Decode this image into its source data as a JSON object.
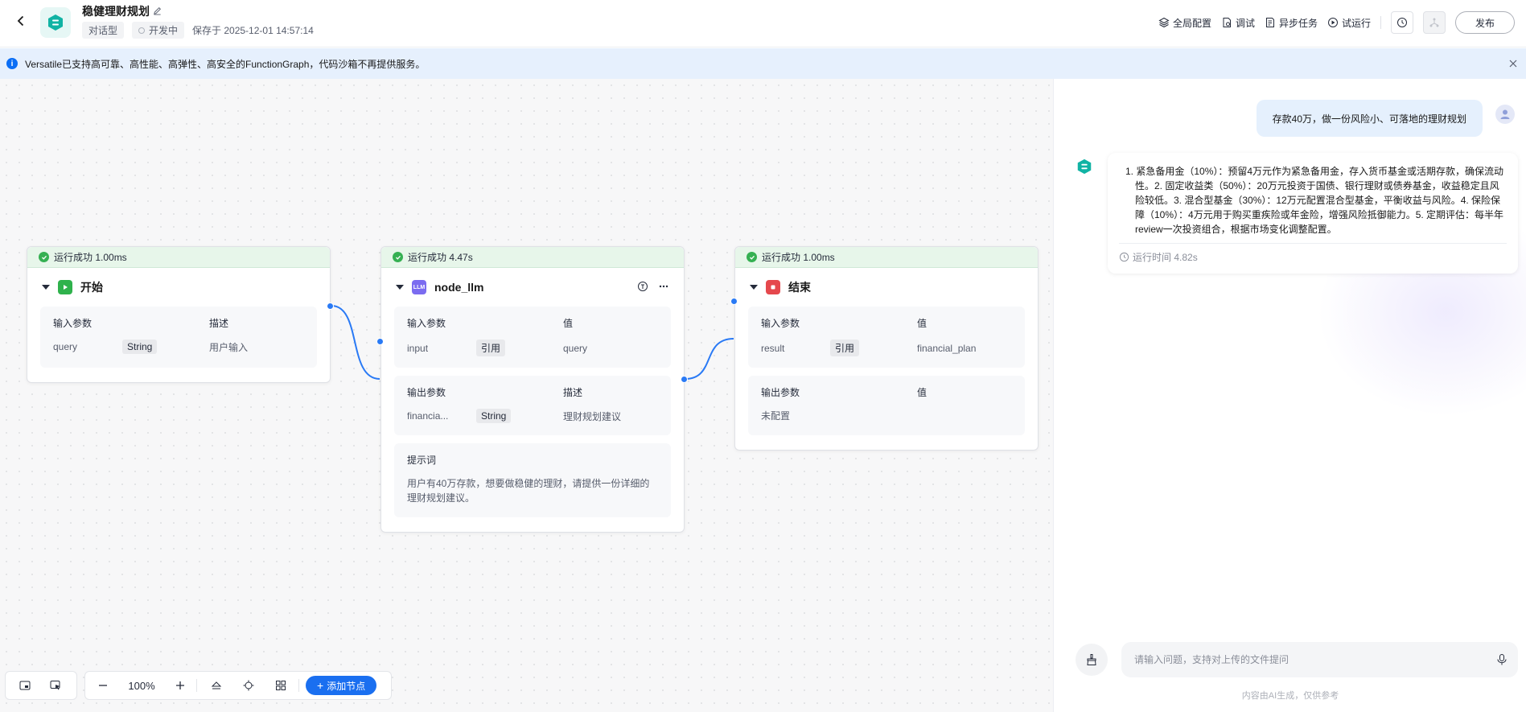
{
  "header": {
    "title": "稳健理财规划",
    "tag_type": "对话型",
    "status": "开发中",
    "saved_at": "保存于 2025-12-01 14:57:14",
    "actions": {
      "global_config": "全局配置",
      "debug": "调试",
      "async_tasks": "异步任务",
      "trial_run": "试运行",
      "publish": "发布"
    }
  },
  "notice": {
    "text": "Versatile已支持高可靠、高性能、高弹性、高安全的FunctionGraph，代码沙箱不再提供服务。"
  },
  "nodes": {
    "start": {
      "status": "运行成功 1.00ms",
      "name": "开始",
      "input_header": [
        "输入参数",
        "描述"
      ],
      "input_row": {
        "name": "query",
        "type": "String",
        "desc": "用户输入"
      }
    },
    "llm": {
      "status": "运行成功 4.47s",
      "name": "node_llm",
      "input_header": [
        "输入参数",
        "值"
      ],
      "input_row": {
        "name": "input",
        "type": "引用",
        "value": "query"
      },
      "output_header": [
        "输出参数",
        "描述"
      ],
      "output_row": {
        "name": "financia...",
        "type": "String",
        "desc": "理财规划建议"
      },
      "prompt_label": "提示词",
      "prompt_text": "用户有40万存款，想要做稳健的理财，请提供一份详细的理财规划建议。"
    },
    "end": {
      "status": "运行成功 1.00ms",
      "name": "结束",
      "input_header": [
        "输入参数",
        "值"
      ],
      "input_row": {
        "name": "result",
        "type": "引用",
        "value": "financial_plan"
      },
      "output_header": [
        "输出参数",
        "值"
      ],
      "output_row": {
        "name": "未配置"
      }
    }
  },
  "canvas_toolbar": {
    "zoom": "100%",
    "add_node": "添加节点"
  },
  "chat": {
    "user_message": "存款40万，做一份风险小、可落地的理财规划",
    "bot_message": "1. 紧急备用金（10%）：预留4万元作为紧急备用金，存入货币基金或活期存款，确保流动性。2. 固定收益类（50%）：20万元投资于国债、银行理财或债券基金，收益稳定且风险较低。3. 混合型基金（30%）：12万元配置混合型基金，平衡收益与风险。4. 保险保障（10%）：4万元用于购买重疾险或年金险，增强风险抵御能力。5. 定期评估：每半年review一次投资组合，根据市场变化调整配置。",
    "run_time": "运行时间 4.82s",
    "input_placeholder": "请输入问题，支持对上传的文件提问",
    "disclaimer": "内容由AI生成，仅供参考"
  },
  "colors": {
    "accent": "#1a6ff0",
    "success": "#35b052",
    "start_icon": "#2fb24c",
    "llm_icon": "#7b6cf0",
    "end_icon": "#e5484d",
    "brand_teal": "#11b3a4"
  }
}
